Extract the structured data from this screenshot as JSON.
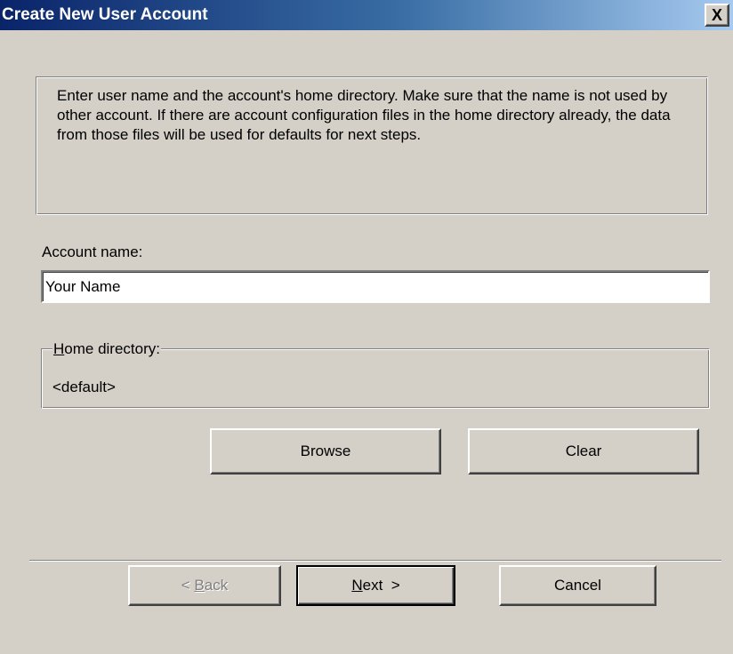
{
  "window": {
    "title": "Create New User Account",
    "close_glyph": "X"
  },
  "info": {
    "text": "Enter user name and the account's home directory. Make sure that the name is not used by other account. If there are account configuration files in the home directory already, the data from those files will be used for defaults for next steps."
  },
  "account": {
    "label": "Account name:",
    "value": "Your Name"
  },
  "home_directory": {
    "label_mnemonic": "H",
    "label_rest": "ome directory:",
    "value": "<default>"
  },
  "buttons": {
    "browse": "Browse",
    "clear": "Clear",
    "back_prefix": "< ",
    "back_mnemonic": "B",
    "back_rest": "ack",
    "next_mnemonic": "N",
    "next_rest": "ext  >",
    "cancel": "Cancel"
  }
}
